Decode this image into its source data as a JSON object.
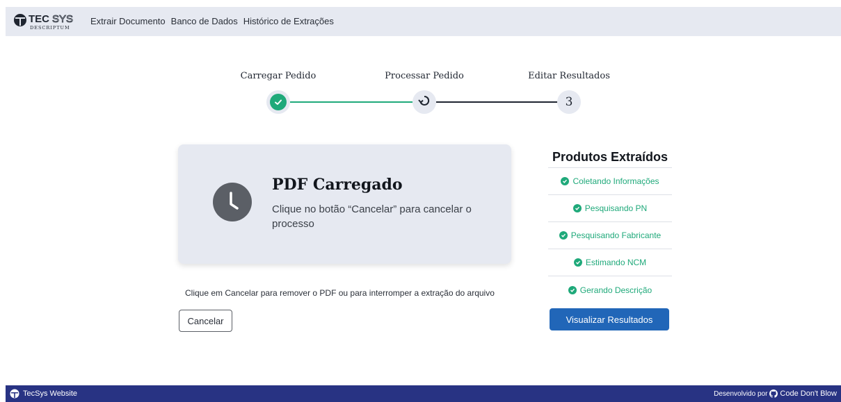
{
  "app": {
    "logo_top": "TECSYS",
    "logo_sub": "DESCRIPTUM"
  },
  "nav": {
    "items": [
      "Extrair Documento",
      "Banco de Dados",
      "Histórico de Extrações"
    ]
  },
  "stepper": {
    "steps": [
      {
        "label": "Carregar Pedido",
        "state": "done"
      },
      {
        "label": "Processar Pedido",
        "state": "active"
      },
      {
        "label": "Editar Resultados",
        "state": "pending",
        "number": "3"
      }
    ],
    "colors": {
      "done": "#1fa97a",
      "line_done": "#1fa97a",
      "line_pending": "#1f2530",
      "circle_bg": "#e6e9f1"
    }
  },
  "card": {
    "title": "PDF Carregado",
    "text": "Clique no botão “Cancelar” para cancelar o processo",
    "icon": "clock-icon"
  },
  "instruction": "Clique em Cancelar para remover o PDF ou para interromper a extração do arquivo",
  "cancel_label": "Cancelar",
  "panel": {
    "title": "Produtos Extraídos",
    "items": [
      "Coletando Informações",
      "Pesquisando PN",
      "Pesquisando Fabricante",
      "Estimando NCM",
      "Gerando Descrição"
    ],
    "item_color": "#1fa97a"
  },
  "view_button": "Visualizar Resultados",
  "footer": {
    "left": "TecSys Website",
    "right_prefix": "Desenvolvido por",
    "right_brand": "Code Don't Blow",
    "bg": "#283383"
  }
}
